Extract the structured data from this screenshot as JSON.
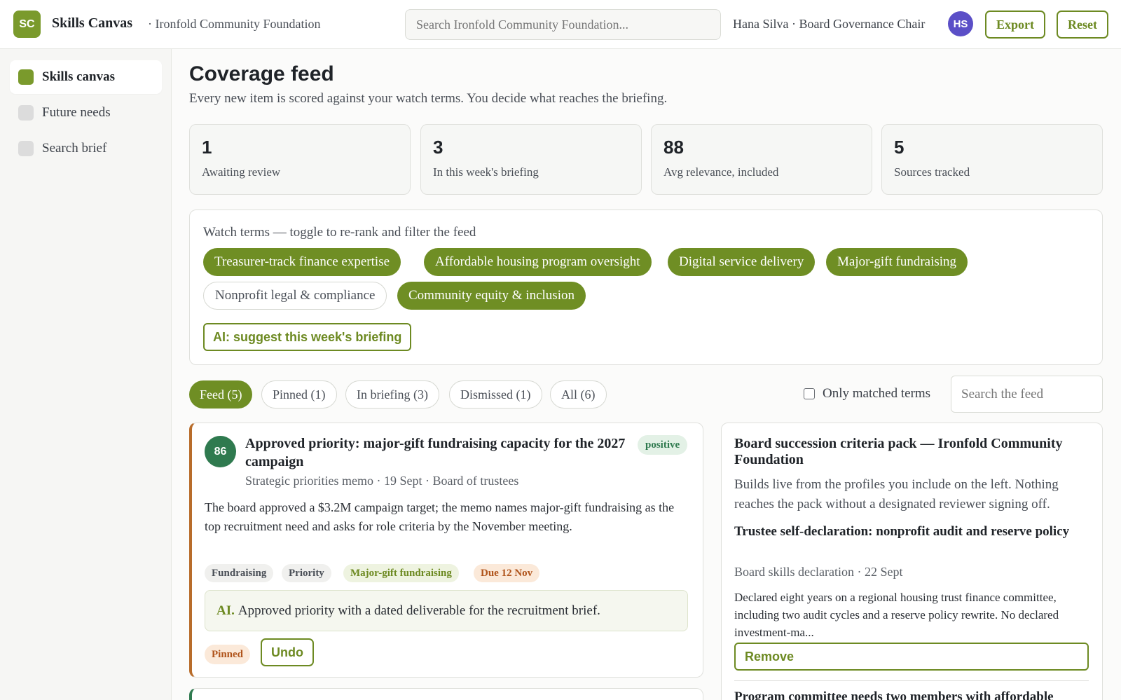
{
  "header": {
    "logo_initials": "SC",
    "app_name": "Skills Canvas",
    "org_name": "· Ironfold Community Foundation",
    "search_placeholder": "Search Ironfold Community Foundation...",
    "user_label": "Hana Silva · Board Governance Chair",
    "avatar_initials": "HS",
    "export_label": "Export",
    "reset_label": "Reset"
  },
  "sidebar": {
    "items": [
      {
        "label": "Skills canvas",
        "active": true
      },
      {
        "label": "Future needs",
        "active": false
      },
      {
        "label": "Search brief",
        "active": false
      }
    ]
  },
  "main": {
    "title": "Coverage feed",
    "subtitle": "Every new item is scored against your watch terms. You decide what reaches the briefing.",
    "stats": [
      {
        "value": "1",
        "label": "Awaiting review"
      },
      {
        "value": "3",
        "label": "In this week's briefing"
      },
      {
        "value": "88",
        "label": "Avg relevance, included"
      },
      {
        "value": "5",
        "label": "Sources tracked"
      }
    ],
    "watch": {
      "title": "Watch terms — toggle to re-rank and filter the feed",
      "terms": [
        {
          "label": "Treasurer-track finance expertise",
          "on": true
        },
        {
          "label": "Affordable housing program oversight",
          "on": true
        },
        {
          "label": "Digital service delivery",
          "on": true
        },
        {
          "label": "Major-gift fundraising",
          "on": true
        },
        {
          "label": "Nonprofit legal & compliance",
          "on": false
        },
        {
          "label": "Community equity & inclusion",
          "on": true
        }
      ],
      "ai_button": "AI: suggest this week's briefing"
    },
    "tabs": [
      {
        "label": "Feed (5)",
        "active": true
      },
      {
        "label": "Pinned (1)",
        "active": false
      },
      {
        "label": "In briefing (3)",
        "active": false
      },
      {
        "label": "Dismissed (1)",
        "active": false
      },
      {
        "label": "All (6)",
        "active": false
      }
    ],
    "only_matched_label": "Only matched terms",
    "feed_search_placeholder": "Search the feed",
    "card": {
      "score": "86",
      "title": "Approved priority: major-gift fundraising capacity for the 2027 campaign",
      "sentiment": "positive",
      "meta": "Strategic priorities memo · 19 Sept · Board of trustees",
      "body": "The board approved a $3.2M campaign target; the memo names major-gift fundraising as the top recruitment need and asks for role criteria by the November meeting.",
      "tags": [
        {
          "label": "Fundraising",
          "style": "grey"
        },
        {
          "label": "Priority",
          "style": "grey"
        },
        {
          "label": "Major-gift fundraising",
          "style": "green"
        },
        {
          "label": "Due 12 Nov",
          "style": "orange"
        }
      ],
      "ai_prefix": "AI.",
      "ai_text": "Approved priority with a dated deliverable for the recruitment brief.",
      "status": "Pinned",
      "undo_label": "Undo"
    },
    "pack": {
      "title": "Board succession criteria pack — Ironfold Community Foundation",
      "desc": "Builds live from the profiles you include on the left. Nothing reaches the pack without a designated reviewer signing off.",
      "item_title": "Trustee self-declaration: nonprofit audit and reserve policy",
      "item_meta": "Board skills declaration · 22 Sept",
      "item_body": "Declared eight years on a regional housing trust finance committee, including two audit cycles and a reserve policy rewrite. No declared investment-ma...",
      "remove_label": "Remove",
      "next_title": "Program committee needs two members with affordable"
    }
  },
  "colors": {
    "accent": "#6f8e24",
    "score_green": "#2f7a4f",
    "pin_orange": "#b86c2a",
    "avatar": "#5b4fc7"
  }
}
